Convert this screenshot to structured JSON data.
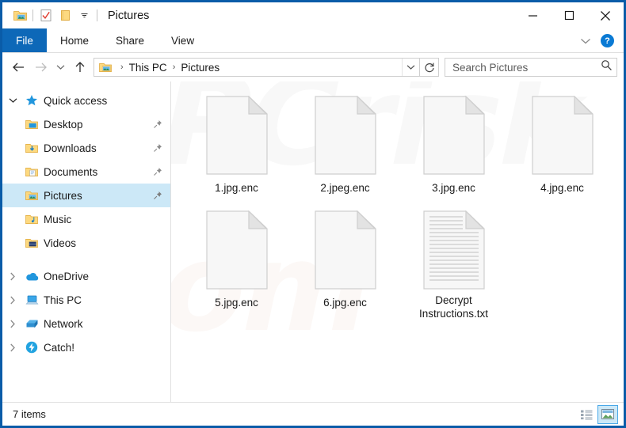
{
  "window": {
    "title": "Pictures",
    "icon": "folder-pictures-icon",
    "quick_access_toolbar": [
      {
        "name": "folder-pictures-icon",
        "label": "Pictures properties"
      },
      {
        "name": "properties-checkmark-icon",
        "label": "Properties"
      },
      {
        "name": "new-folder-icon",
        "label": "New folder"
      },
      {
        "name": "chevron-down-icon",
        "label": "Customize Quick Access Toolbar"
      }
    ],
    "controls": {
      "minimize": "–",
      "maximize": "□",
      "close": "✕"
    }
  },
  "ribbon": {
    "file_tab": "File",
    "tabs": [
      "Home",
      "Share",
      "View"
    ],
    "expand_icon": "chevron-down-icon",
    "help_label": "?"
  },
  "address": {
    "back_icon": "arrow-left-icon",
    "forward_icon": "arrow-right-icon",
    "recent_icon": "chevron-down-icon",
    "up_icon": "arrow-up-icon",
    "crumb_icon": "folder-pictures-icon",
    "breadcrumbs": [
      "This PC",
      "Pictures"
    ],
    "separator": "›",
    "dropdown_icon": "chevron-down-icon",
    "refresh_icon": "refresh-icon"
  },
  "search": {
    "placeholder": "Search Pictures",
    "icon": "search-icon"
  },
  "sidebar": {
    "groups": [
      {
        "label": "Quick access",
        "icon": "star-icon",
        "expander": "chevron-down-icon",
        "expanded": true,
        "selected": false,
        "children": [
          {
            "label": "Desktop",
            "icon": "folder-desktop-icon",
            "pinned": true,
            "selected": false
          },
          {
            "label": "Downloads",
            "icon": "folder-downloads-icon",
            "pinned": true,
            "selected": false
          },
          {
            "label": "Documents",
            "icon": "folder-documents-icon",
            "pinned": true,
            "selected": false
          },
          {
            "label": "Pictures",
            "icon": "folder-pictures-icon",
            "pinned": true,
            "selected": true
          },
          {
            "label": "Music",
            "icon": "folder-music-icon",
            "pinned": false,
            "selected": false
          },
          {
            "label": "Videos",
            "icon": "folder-videos-icon",
            "pinned": false,
            "selected": false
          }
        ]
      },
      {
        "label": "OneDrive",
        "icon": "onedrive-cloud-icon",
        "expander": "chevron-right-icon",
        "expanded": false,
        "selected": false,
        "children": []
      },
      {
        "label": "This PC",
        "icon": "this-pc-icon",
        "expander": "chevron-right-icon",
        "expanded": false,
        "selected": false,
        "children": []
      },
      {
        "label": "Network",
        "icon": "network-icon",
        "expander": "chevron-right-icon",
        "expanded": false,
        "selected": false,
        "children": []
      },
      {
        "label": "Catch!",
        "icon": "catch-lightning-icon",
        "expander": "chevron-right-icon",
        "expanded": false,
        "selected": false,
        "children": []
      }
    ]
  },
  "files": [
    {
      "name": "1.jpg.enc",
      "icon": "blank-file-icon"
    },
    {
      "name": "2.jpeg.enc",
      "icon": "blank-file-icon"
    },
    {
      "name": "3.jpg.enc",
      "icon": "blank-file-icon"
    },
    {
      "name": "4.jpg.enc",
      "icon": "blank-file-icon"
    },
    {
      "name": "5.jpg.enc",
      "icon": "blank-file-icon"
    },
    {
      "name": "6.jpg.enc",
      "icon": "blank-file-icon"
    },
    {
      "name": "Decrypt Instructions.txt",
      "icon": "text-file-icon"
    }
  ],
  "status": {
    "item_count": "7 items",
    "views": [
      {
        "name": "details-view-button",
        "active": false
      },
      {
        "name": "large-icons-view-button",
        "active": true
      }
    ]
  },
  "colors": {
    "window_border": "#0a5ca8",
    "file_tab": "#0d68b8",
    "selection": "#cce8f7",
    "accent_blue": "#0a7ad4",
    "folder_yellow": "#ffcf5c"
  }
}
